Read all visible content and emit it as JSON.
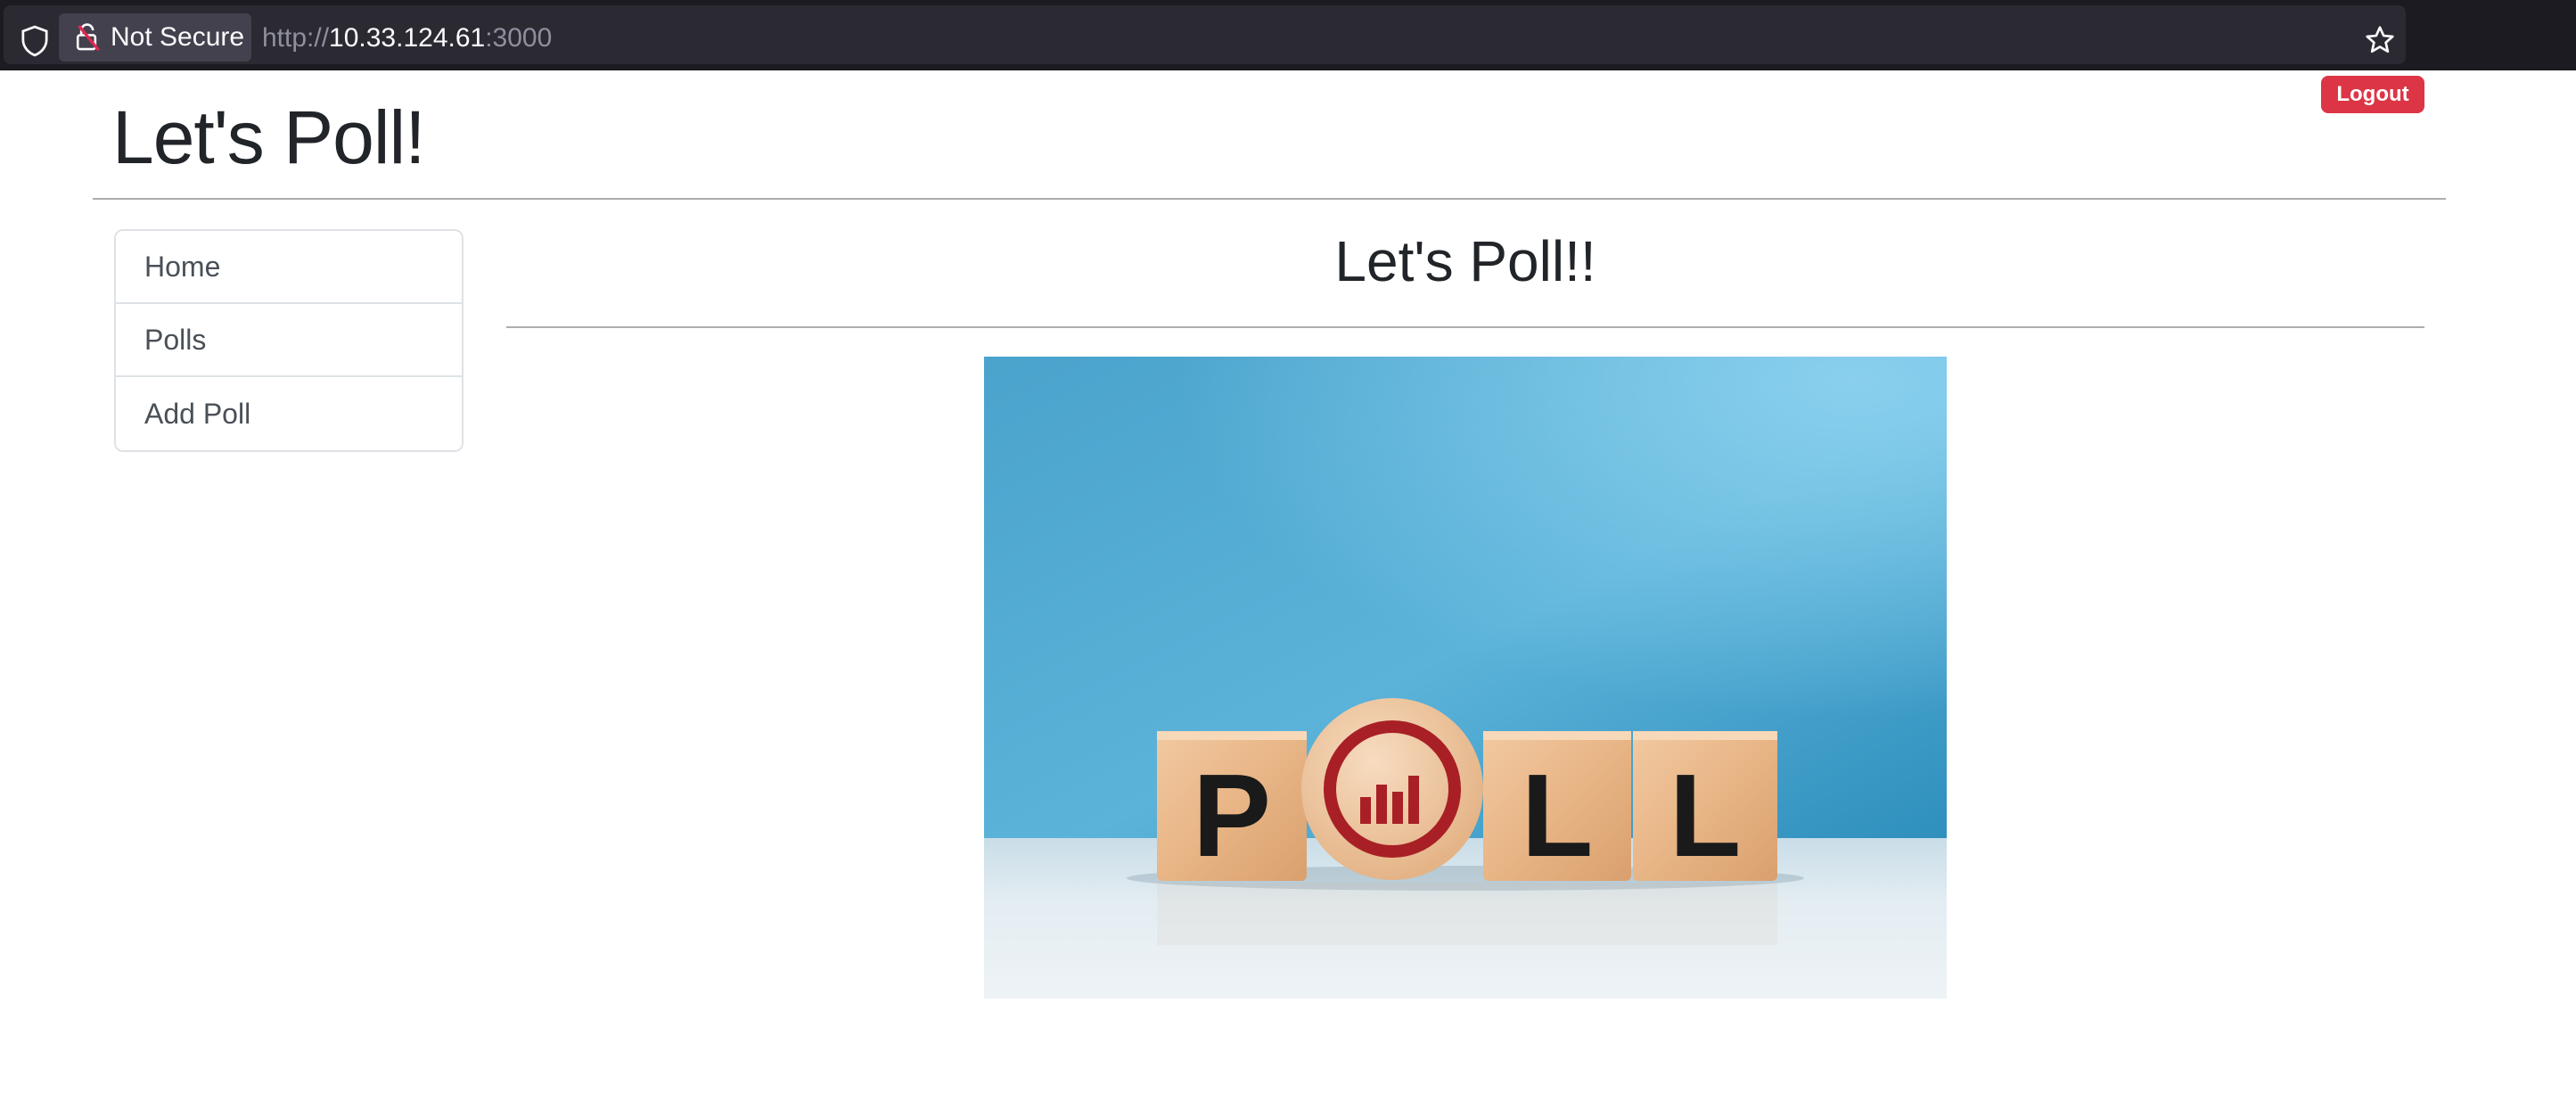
{
  "browser": {
    "security_label": "Not Secure",
    "url_scheme": "http://",
    "url_host": "10.33.124.61",
    "url_port": ":3000",
    "icons": [
      "shield-icon",
      "lock-warning-icon",
      "star-bookmark-icon"
    ]
  },
  "header": {
    "title": "Let's Poll!",
    "logout_label": "Logout"
  },
  "sidebar": {
    "items": [
      {
        "label": "Home"
      },
      {
        "label": "Polls"
      },
      {
        "label": "Add Poll"
      }
    ]
  },
  "main": {
    "title": "Let's Poll!!",
    "hero_letters": [
      "P",
      "L",
      "L"
    ]
  },
  "colors": {
    "danger": "#dc3545",
    "browser_bg": "#1c1b22",
    "url_bg": "#2b2a33",
    "poll_icon_red": "#a82026",
    "sky_blue": "#4fa8d0"
  }
}
